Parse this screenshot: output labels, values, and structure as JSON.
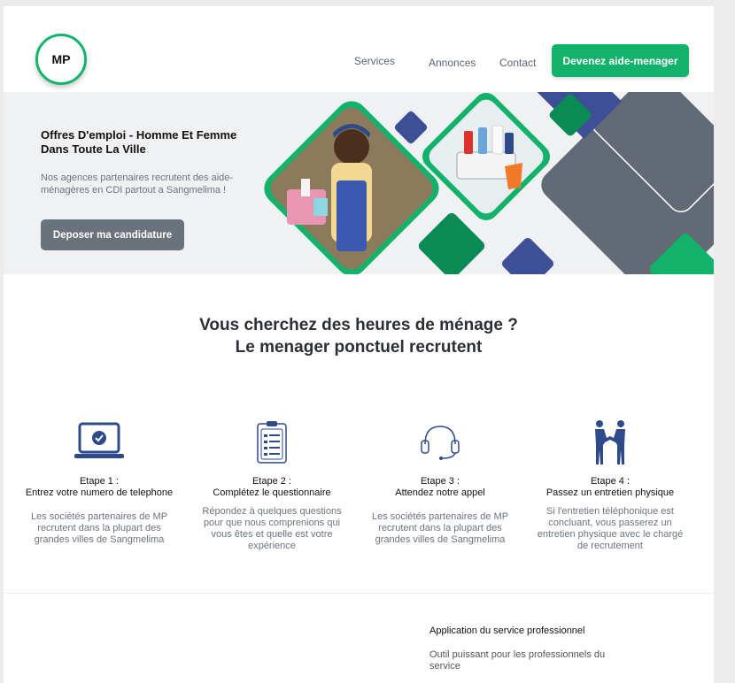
{
  "header": {
    "logo": "MP",
    "nav": [
      "Services",
      "Annonces",
      "Contact"
    ],
    "cta": "Devenez aide-menager"
  },
  "hero": {
    "title": "Offres D'emploi - Homme Et Femme Dans Toute La Ville",
    "text": "Nos agences partenaires recrutent des aide-ménagères en CDI partout a Sangmelima !",
    "button": "Deposer ma candidature"
  },
  "section": {
    "title_line1": "Vous cherchez des heures de ménage ?",
    "title_line2": "Le menager ponctuel recrutent"
  },
  "steps": [
    {
      "number": "Etape 1 :",
      "title": "Entrez votre numero de telephone",
      "description": "Les sociétés partenaires de MP recrutent dans la plupart des grandes villes de Sangmelima",
      "icon": "laptop-check-icon"
    },
    {
      "number": "Etape 2 :",
      "title": "Complétez le questionnaire",
      "description": "Répondez à quelques questions pour que nous comprenions qui vous êtes et quelle est votre expérience",
      "icon": "clipboard-checklist-icon"
    },
    {
      "number": "Etape 3 :",
      "title": "Attendez notre appel",
      "description": "Les sociétés partenaires de MP recrutent dans la plupart des grandes villes de Sangmelima",
      "icon": "headset-icon"
    },
    {
      "number": "Etape 4 :",
      "title": "Passez un entretien physique",
      "description": "Si l'entretien téléphonique est concluant, vous passerez un entretien physique avec le chargé de recrutement",
      "icon": "handshake-icon"
    }
  ],
  "app": {
    "title": "Application du service professionnel",
    "description": "Outil  puissant pour les professionnels du service"
  },
  "colors": {
    "brand_green": "#12b26b",
    "dark_green": "#0a8a55",
    "navy": "#3d4f96",
    "slate": "#626a75",
    "icon_blue": "#2f4a8a"
  }
}
